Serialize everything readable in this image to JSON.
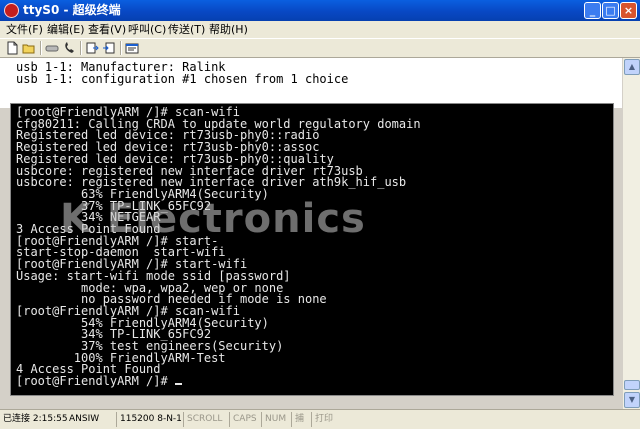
{
  "window": {
    "title": "ttyS0 - 超级终端"
  },
  "menu": [
    {
      "label": "文件(F)"
    },
    {
      "label": "编辑(E)"
    },
    {
      "label": "查看(V)"
    },
    {
      "label": "呼叫(C)"
    },
    {
      "label": "传送(T)"
    },
    {
      "label": "帮助(H)"
    }
  ],
  "toolbar": {
    "icons": [
      "new-icon",
      "open-icon",
      "disconnect-icon",
      "call-icon",
      "send-icon",
      "receive-icon",
      "properties-icon"
    ]
  },
  "top_area": {
    "lines": "usb 1-1: Manufacturer: Ralink\nusb 1-1: configuration #1 chosen from 1 choice"
  },
  "terminal": {
    "text": "[root@FriendlyARM /]# scan-wifi\ncfg80211: Calling CRDA to update world regulatory domain\nRegistered led device: rt73usb-phy0::radio\nRegistered led device: rt73usb-phy0::assoc\nRegistered led device: rt73usb-phy0::quality\nusbcore: registered new interface driver rt73usb\nusbcore: registered new interface driver ath9k_hif_usb\n         63% FriendlyARM4(Security)\n         37% TP-LINK_65FC92\n         34% NETGEAR\n3 Access Point Found\n[root@FriendlyARM /]# start-\nstart-stop-daemon  start-wifi\n[root@FriendlyARM /]# start-wifi\nUsage: start-wifi mode ssid [password]\n         mode: wpa, wpa2, wep or none\n         no password needed if mode is none\n[root@FriendlyARM /]# scan-wifi\n         54% FriendlyARM4(Security)\n         34% TP-LINK_65FC92\n         37% test engineers(Security)\n        100% FriendlyARM-Test\n4 Access Point Found\n[root@FriendlyARM /]# ",
    "watermark": "K Electronics"
  },
  "status": {
    "connected": "已连接 2:15:55",
    "emulation": "ANSIW",
    "settings": "115200 8-N-1",
    "scroll": "SCROLL",
    "caps": "CAPS",
    "num": "NUM",
    "capture": "捕",
    "print": "打印"
  },
  "colors": {
    "title_bar": "#0848C4",
    "terminal_bg": "#000000",
    "terminal_fg": "#E8E8E8"
  }
}
